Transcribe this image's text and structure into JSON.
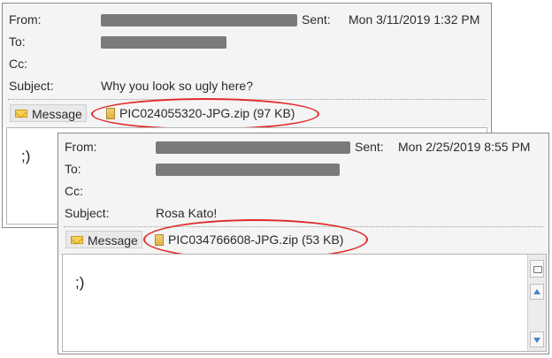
{
  "labels": {
    "from": "From:",
    "to": "To:",
    "cc": "Cc:",
    "subject": "Subject:",
    "sent": "Sent:",
    "message_tab": "Message"
  },
  "email_back": {
    "sent_value": "Mon 3/11/2019 1:32 PM",
    "subject": "Why you look so ugly here?",
    "attachment": "PIC024055320-JPG.zip (97 KB)",
    "body": ";)"
  },
  "email_front": {
    "sent_value": "Mon 2/25/2019 8:55 PM",
    "subject": "Rosa Kato!",
    "attachment": "PIC034766608-JPG.zip (53 KB)",
    "body": ";)"
  },
  "colors": {
    "highlight": "#e12a2a",
    "redaction": "#7b7b7b",
    "header_bg": "#f4f4f4"
  },
  "icons": {
    "message": "envelope-icon",
    "attachment": "zip-file-icon"
  }
}
